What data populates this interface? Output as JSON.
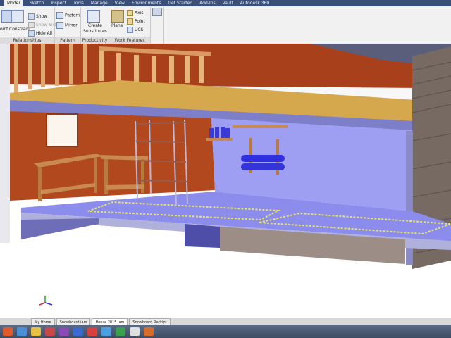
{
  "menu": {
    "items": [
      "Model",
      "Sketch",
      "Inspect",
      "Tools",
      "Manage",
      "View",
      "Environments",
      "Get Started",
      "Add-Ins",
      "Vault",
      "Autodesk 360"
    ]
  },
  "ribbon": {
    "point_label": "oint",
    "constrain_label": "Constrain",
    "show_label": "Show",
    "show_sick_label": "Show Sick",
    "hide_all_label": "Hide All",
    "pattern_label": "Pattern",
    "mirror_label": "Mirror",
    "create_substitutes_label": "Create Substitutes",
    "plane_label": "Plane",
    "axis_label": "Axis",
    "point2_label": "Point",
    "ucs_label": "UCS",
    "panels": {
      "relationships": "Relationships",
      "pattern": "Pattern",
      "productivity": "Productivity",
      "work_features": "Work Features"
    }
  },
  "tabs": [
    "My Home",
    "Snowboard.iam",
    "House 2015.iam",
    "Snowboard Rackipt"
  ],
  "colors": {
    "wall_orange": "#b04a1f",
    "floor_blue": "#8f8ff0",
    "ceiling_yellow": "#d8a84c",
    "board_blue": "#3030e0"
  }
}
